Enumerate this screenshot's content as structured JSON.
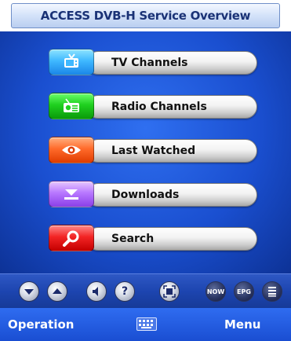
{
  "window": {
    "title": "ACCESS DVB-H Service Overview"
  },
  "menu": {
    "items": [
      {
        "label": "TV Channels",
        "icon": "tv-icon",
        "color": "#3fb8ff"
      },
      {
        "label": "Radio Channels",
        "icon": "radio-icon",
        "color": "#1fd01f"
      },
      {
        "label": "Last Watched",
        "icon": "eye-icon",
        "color": "#ff6a2a"
      },
      {
        "label": "Downloads",
        "icon": "download-icon",
        "color": "#b878ff"
      },
      {
        "label": "Search",
        "icon": "magnifier-icon",
        "color": "#f22424"
      }
    ]
  },
  "toolbar": {
    "buttons": [
      {
        "icon": "scroll-down-icon"
      },
      {
        "icon": "scroll-up-icon"
      },
      {
        "icon": "volume-icon"
      },
      {
        "icon": "help-icon",
        "label": "?"
      },
      {
        "icon": "fullscreen-icon"
      },
      {
        "icon": "now-icon",
        "label": "NOW"
      },
      {
        "icon": "epg-icon",
        "label": "EPG"
      },
      {
        "icon": "list-icon"
      }
    ]
  },
  "softkeys": {
    "left": "Operation",
    "right": "Menu",
    "center_icon": "keyboard-icon"
  },
  "colors": {
    "title_text": "#1a3276",
    "main_bg": "#1a4fd0",
    "softkey_bg": "#1f55d8"
  }
}
